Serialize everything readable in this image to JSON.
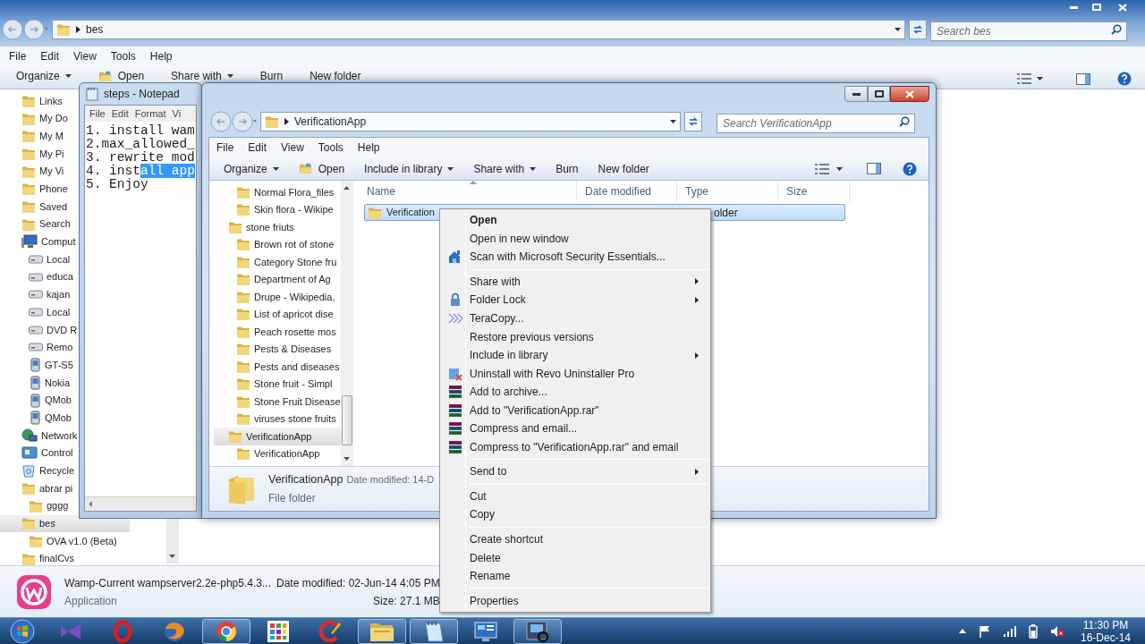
{
  "background_window": {
    "address": "bes",
    "search": {
      "placeholder": "Search bes"
    },
    "menu": [
      "File",
      "Edit",
      "View",
      "Tools",
      "Help"
    ],
    "toolbar": [
      {
        "label": "Organize",
        "kind": "menu"
      },
      {
        "label": "Open",
        "kind": "open"
      },
      {
        "label": "Share with",
        "kind": "menu"
      },
      {
        "label": "Burn",
        "kind": "command"
      },
      {
        "label": "New folder",
        "kind": "command"
      }
    ],
    "nav_tree": [
      {
        "label": "Links",
        "kind": "folder",
        "selected": false
      },
      {
        "label": "My Do",
        "kind": "folder",
        "selected": false
      },
      {
        "label": "My M",
        "kind": "folder",
        "selected": false
      },
      {
        "label": "My Pi",
        "kind": "folder",
        "selected": false
      },
      {
        "label": "My Vi",
        "kind": "folder",
        "selected": false
      },
      {
        "label": "Phone",
        "kind": "folder",
        "selected": false
      },
      {
        "label": "Saved",
        "kind": "folder",
        "selected": false
      },
      {
        "label": "Search",
        "kind": "folder",
        "selected": false
      },
      {
        "label": "Comput",
        "kind": "computer",
        "selected": false,
        "children": [
          {
            "label": "Local",
            "kind": "drive",
            "selected": false
          },
          {
            "label": "educa",
            "kind": "drive",
            "selected": false
          },
          {
            "label": "kajan",
            "kind": "drive",
            "selected": false
          },
          {
            "label": "Local",
            "kind": "drive",
            "selected": false
          },
          {
            "label": "DVD R",
            "kind": "drive",
            "selected": false
          },
          {
            "label": "Remo",
            "kind": "drive",
            "selected": false
          },
          {
            "label": "GT-S5",
            "kind": "device",
            "selected": false
          },
          {
            "label": "Nokia",
            "kind": "device",
            "selected": false
          },
          {
            "label": "QMob",
            "kind": "device",
            "selected": false
          },
          {
            "label": "QMob",
            "kind": "device",
            "selected": false
          }
        ]
      },
      {
        "label": "Network",
        "kind": "network",
        "selected": false
      },
      {
        "label": "Control",
        "kind": "control",
        "selected": false
      },
      {
        "label": "Recycle",
        "kind": "recycle",
        "selected": false
      },
      {
        "label": "abrar pi",
        "kind": "folder",
        "selected": false,
        "children": [
          {
            "label": "gggg",
            "kind": "folder",
            "selected": false
          }
        ]
      },
      {
        "label": "bes",
        "kind": "folder",
        "selected": true,
        "children": [
          {
            "label": "OVA v1.0 (Beta)",
            "kind": "folder",
            "selected": false
          }
        ]
      },
      {
        "label": "finalCvs",
        "kind": "folder",
        "selected": false
      }
    ],
    "details": {
      "name": "Wamp-Current wampserver2.2e-php5.4.3...",
      "type": "Application",
      "date_modified": "Date modified: 02-Jun-14 4:05 PM",
      "size": "Size: 27.1 MB"
    }
  },
  "notepad": {
    "title": "steps - Notepad",
    "menu": [
      "File",
      "Edit",
      "Format",
      "Vi"
    ],
    "lines": [
      {
        "text": "1. install wam"
      },
      {
        "text": "2.max_allowed_"
      },
      {
        "text": "3. rewrite mod"
      },
      {
        "text": "4. inst",
        "selection": "all app"
      },
      {
        "text": "5. Enjoy"
      }
    ]
  },
  "front_window": {
    "address": "VerificationApp",
    "search": {
      "placeholder": "Search VerificationApp"
    },
    "menu": [
      "File",
      "Edit",
      "View",
      "Tools",
      "Help"
    ],
    "toolbar": [
      {
        "label": "Organize",
        "kind": "menu"
      },
      {
        "label": "Open",
        "kind": "open"
      },
      {
        "label": "Include in library",
        "kind": "menu"
      },
      {
        "label": "Share with",
        "kind": "menu"
      },
      {
        "label": "Burn",
        "kind": "command"
      },
      {
        "label": "New folder",
        "kind": "command"
      }
    ],
    "tree": [
      {
        "label": "Normal Flora_files",
        "selected": false
      },
      {
        "label": "Skin flora - Wikipe",
        "selected": false
      },
      {
        "label": "stone friuts",
        "selected": false,
        "children": [
          {
            "label": "Brown rot of stone",
            "selected": false
          },
          {
            "label": "Category Stone fru",
            "selected": false
          },
          {
            "label": "Department of Ag",
            "selected": false
          },
          {
            "label": "Drupe - Wikipedia,",
            "selected": false
          },
          {
            "label": "List of apricot dise",
            "selected": false
          },
          {
            "label": "Peach rosette mos",
            "selected": false
          },
          {
            "label": "Pests & Diseases",
            "selected": false
          },
          {
            "label": "Pests and diseases",
            "selected": false
          },
          {
            "label": "Stone fruit - Simpl",
            "selected": false
          },
          {
            "label": "Stone Fruit Disease",
            "selected": false
          },
          {
            "label": "viruses stone fruits",
            "selected": false
          }
        ]
      },
      {
        "label": "VerificationApp",
        "selected": true,
        "children": [
          {
            "label": "VerificationApp",
            "selected": false
          }
        ]
      }
    ],
    "columns": [
      "Name",
      "Date modified",
      "Type",
      "Size"
    ],
    "rows": [
      {
        "name": "Verification",
        "type": "older",
        "selected": true
      }
    ],
    "details": {
      "name": "VerificationApp",
      "date_modified": "Date modified: 14-D",
      "type": "File folder"
    }
  },
  "context_menu": [
    {
      "kind": "plain",
      "label": "Open",
      "default": true,
      "submenu": false
    },
    {
      "kind": "plain",
      "label": "Open in new window",
      "default": false,
      "submenu": false
    },
    {
      "kind": "security",
      "label": "Scan with Microsoft Security Essentials...",
      "default": false,
      "submenu": false
    },
    {
      "kind": "separator"
    },
    {
      "kind": "plain",
      "label": "Share with",
      "default": false,
      "submenu": true
    },
    {
      "kind": "lock",
      "label": "Folder Lock",
      "default": false,
      "submenu": true
    },
    {
      "kind": "copy",
      "label": "TeraCopy...",
      "default": false,
      "submenu": false
    },
    {
      "kind": "plain",
      "label": "Restore previous versions",
      "default": false,
      "submenu": false
    },
    {
      "kind": "plain",
      "label": "Include in library",
      "default": false,
      "submenu": true
    },
    {
      "kind": "uninstall",
      "label": "Uninstall with Revo Uninstaller Pro",
      "default": false,
      "submenu": false
    },
    {
      "kind": "archive",
      "label": "Add to archive...",
      "default": false,
      "submenu": false
    },
    {
      "kind": "archive",
      "label": "Add to \"VerificationApp.rar\"",
      "default": false,
      "submenu": false
    },
    {
      "kind": "archive",
      "label": "Compress and email...",
      "default": false,
      "submenu": false
    },
    {
      "kind": "archive",
      "label": "Compress to \"VerificationApp.rar\" and email",
      "default": false,
      "submenu": false
    },
    {
      "kind": "separator"
    },
    {
      "kind": "plain",
      "label": "Send to",
      "default": false,
      "submenu": true
    },
    {
      "kind": "separator"
    },
    {
      "kind": "plain",
      "label": "Cut",
      "default": false,
      "submenu": false
    },
    {
      "kind": "plain",
      "label": "Copy",
      "default": false,
      "submenu": false
    },
    {
      "kind": "separator"
    },
    {
      "kind": "plain",
      "label": "Create shortcut",
      "default": false,
      "submenu": false
    },
    {
      "kind": "plain",
      "label": "Delete",
      "default": false,
      "submenu": false
    },
    {
      "kind": "plain",
      "label": "Rename",
      "default": false,
      "submenu": false
    },
    {
      "kind": "separator"
    },
    {
      "kind": "plain",
      "label": "Properties",
      "default": false,
      "submenu": false
    }
  ],
  "taskbar": {
    "apps": [
      {
        "kind": "bow",
        "running": false
      },
      {
        "kind": "ring",
        "running": false
      },
      {
        "kind": "fox",
        "running": false
      },
      {
        "kind": "chrome",
        "running": true
      },
      {
        "kind": "grid",
        "running": false
      },
      {
        "kind": "cleaner",
        "running": false
      },
      {
        "kind": "folder",
        "running": true
      },
      {
        "kind": "notepad",
        "running": true
      },
      {
        "kind": "remote",
        "running": false
      },
      {
        "kind": "film",
        "running": true
      }
    ],
    "time": "11:30 PM",
    "date": "16-Dec-14"
  }
}
